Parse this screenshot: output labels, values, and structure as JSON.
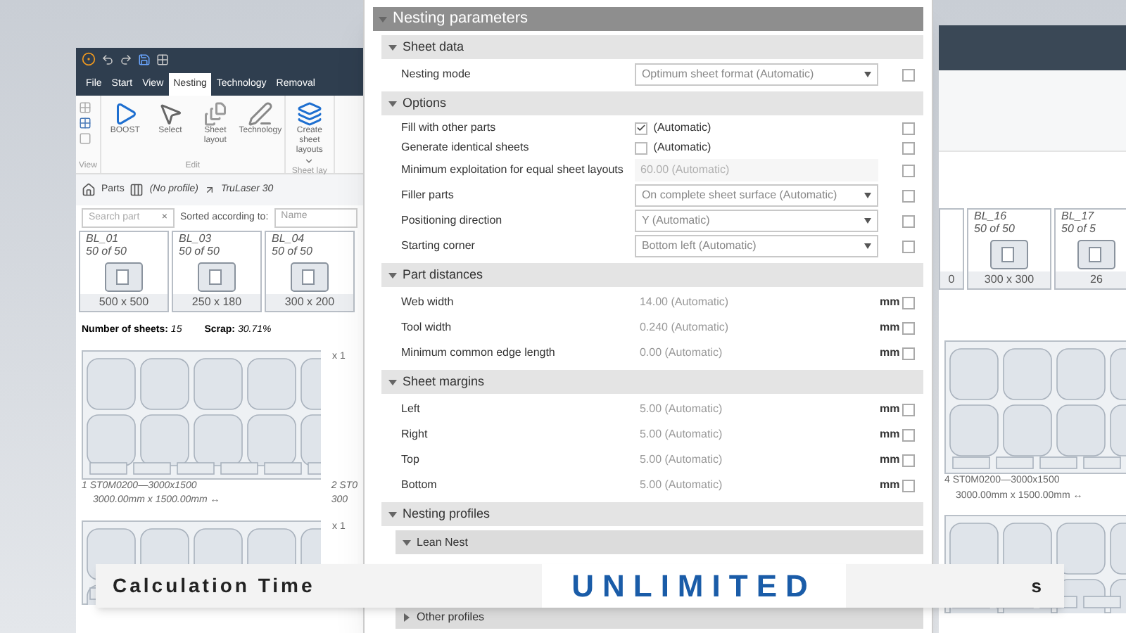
{
  "left_window": {
    "tabs": [
      {
        "label": "File",
        "selected": false
      },
      {
        "label": "Start",
        "selected": false
      },
      {
        "label": "View",
        "selected": false
      },
      {
        "label": "Nesting",
        "selected": true
      },
      {
        "label": "Technology",
        "selected": false
      },
      {
        "label": "Removal",
        "selected": false
      }
    ],
    "ribbon": [
      {
        "label": "View",
        "kind": "view"
      },
      {
        "label": "Edit",
        "buttons": [
          {
            "kind": "boost",
            "label": "BOOST"
          },
          {
            "kind": "select",
            "label": "Select"
          },
          {
            "kind": "sheet",
            "label": "Sheet layout"
          },
          {
            "kind": "tech",
            "label": "Technology"
          }
        ]
      },
      {
        "label": "Sheet lay",
        "buttons": [
          {
            "kind": "create",
            "label": "Create sheet layouts",
            "dropdown": true
          }
        ]
      }
    ],
    "parts_bar": {
      "label": "Parts",
      "profile": "(No profile)",
      "machine": "TruLaser 30"
    },
    "search": {
      "placeholder": "Search part",
      "clear": "×",
      "sort_label": "Sorted according to:",
      "sort_value": "Name"
    },
    "parts": [
      {
        "name": "BL_01",
        "count": "50 of 50",
        "size": "500 x 500"
      },
      {
        "name": "BL_03",
        "count": "50 of 50",
        "size": "250 x 180"
      },
      {
        "name": "BL_04",
        "count": "50 of 50",
        "size": "300 x 200"
      }
    ],
    "summary": {
      "sheets_label": "Number of sheets:",
      "sheets": "15",
      "scrap_label": "Scrap:",
      "scrap": "30.71%"
    },
    "sheets": [
      {
        "quantity": "x 1",
        "title": "1 ST0M0200—3000x1500",
        "dimensions": "3000.00mm x 1500.00mm ↔",
        "next_title": "2 ST0",
        "next_dimensions": "300"
      },
      {
        "quantity": "x 1"
      }
    ]
  },
  "parameters": {
    "title": "Nesting parameters",
    "expanded": true,
    "sections": [
      {
        "title": "Sheet data",
        "expanded": true,
        "rows": [
          {
            "kind": "dropdown",
            "label": "Nesting mode",
            "value": "Optimum sheet format (Automatic)",
            "locked": false
          }
        ]
      },
      {
        "title": "Options",
        "expanded": true,
        "rows": [
          {
            "kind": "check",
            "label": "Fill with other parts",
            "value": "(Automatic)",
            "checked": true,
            "locked": false
          },
          {
            "kind": "check",
            "label": "Generate identical sheets",
            "value": "(Automatic)",
            "checked": false,
            "locked": false
          },
          {
            "kind": "field",
            "label": "Minimum exploitation for equal sheet layouts",
            "value": "60.00 (Automatic)",
            "disabled": true,
            "locked": false
          },
          {
            "kind": "dropdown",
            "label": "Filler parts",
            "value": "On complete sheet surface (Automatic)",
            "locked": false
          },
          {
            "kind": "dropdown",
            "label": "Positioning direction",
            "value": "Y (Automatic)",
            "locked": false
          },
          {
            "kind": "dropdown",
            "label": "Starting corner",
            "value": "Bottom left (Automatic)",
            "locked": false
          }
        ]
      },
      {
        "title": "Part distances",
        "expanded": true,
        "rows": [
          {
            "kind": "field",
            "label": "Web width",
            "value": "14.00 (Automatic)",
            "unit": "mm",
            "disabled": false,
            "locked": false
          },
          {
            "kind": "field",
            "label": "Tool width",
            "value": "0.240 (Automatic)",
            "unit": "mm",
            "disabled": false,
            "locked": false
          },
          {
            "kind": "field",
            "label": "Minimum common edge length",
            "value": "0.00 (Automatic)",
            "unit": "mm",
            "disabled": false,
            "locked": false
          }
        ]
      },
      {
        "title": "Sheet margins",
        "expanded": true,
        "rows": [
          {
            "kind": "field",
            "label": "Left",
            "value": "5.00 (Automatic)",
            "unit": "mm",
            "disabled": false,
            "locked": false
          },
          {
            "kind": "field",
            "label": "Right",
            "value": "5.00 (Automatic)",
            "unit": "mm",
            "disabled": false,
            "locked": false
          },
          {
            "kind": "field",
            "label": "Top",
            "value": "5.00 (Automatic)",
            "unit": "mm",
            "disabled": false,
            "locked": false
          },
          {
            "kind": "field",
            "label": "Bottom",
            "value": "5.00 (Automatic)",
            "unit": "mm",
            "disabled": false,
            "locked": false
          }
        ]
      },
      {
        "title": "Nesting profiles",
        "expanded": true,
        "subsections": [
          {
            "title": "Lean Nest",
            "expanded": true
          },
          {
            "title": "Other profiles",
            "expanded": false
          }
        ]
      }
    ]
  },
  "right_window": {
    "parts": [
      {
        "size": "0"
      },
      {
        "name": "BL_16",
        "count": "50 of 50",
        "size": "300 x 300"
      },
      {
        "name": "BL_17",
        "count": "50 of 5",
        "size": "26"
      }
    ],
    "sheets": [
      {
        "title": "4 ST0M0200—3000x1500",
        "dimensions": "3000.00mm x 1500.00mm ↔"
      }
    ]
  },
  "banner": {
    "label": "Calculation Time",
    "highlight": "UNLIMITED",
    "suffix": "s"
  }
}
